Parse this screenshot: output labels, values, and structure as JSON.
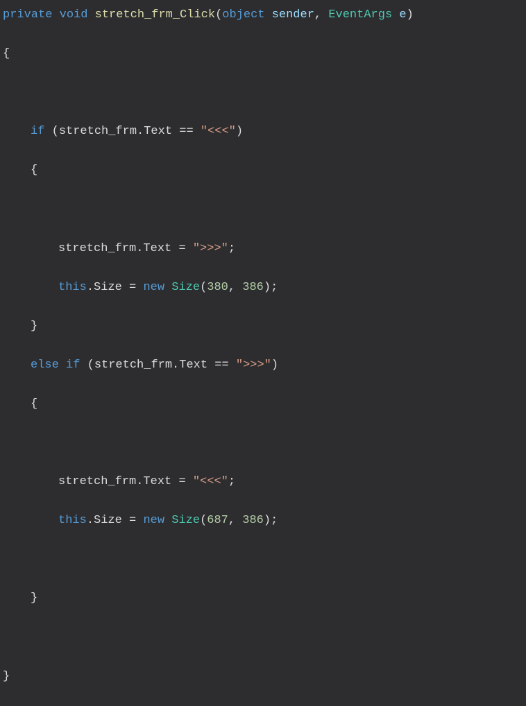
{
  "code": {
    "kw_private": "private",
    "kw_void": "void",
    "method_name": "stretch_frm_Click",
    "paren_open": "(",
    "kw_object": "object",
    "param_sender": "sender",
    "comma": ", ",
    "type_eventargs": "EventArgs",
    "param_e": "e",
    "paren_close": ")",
    "brace_open": "{",
    "brace_close": "}",
    "kw_if": "if",
    "kw_else": "else",
    "kw_this": "this",
    "kw_new": "new",
    "ident_stretch_frm": "stretch_frm",
    "dot": ".",
    "prop_text": "Text",
    "prop_size": "Size",
    "type_size": "Size",
    "op_eq": "==",
    "op_assign": "=",
    "str_lt": "\"<<<\"",
    "str_gt": "\">>>\"",
    "semicolon": ";",
    "num_380": "380",
    "num_386": "386",
    "num_687": "687"
  }
}
